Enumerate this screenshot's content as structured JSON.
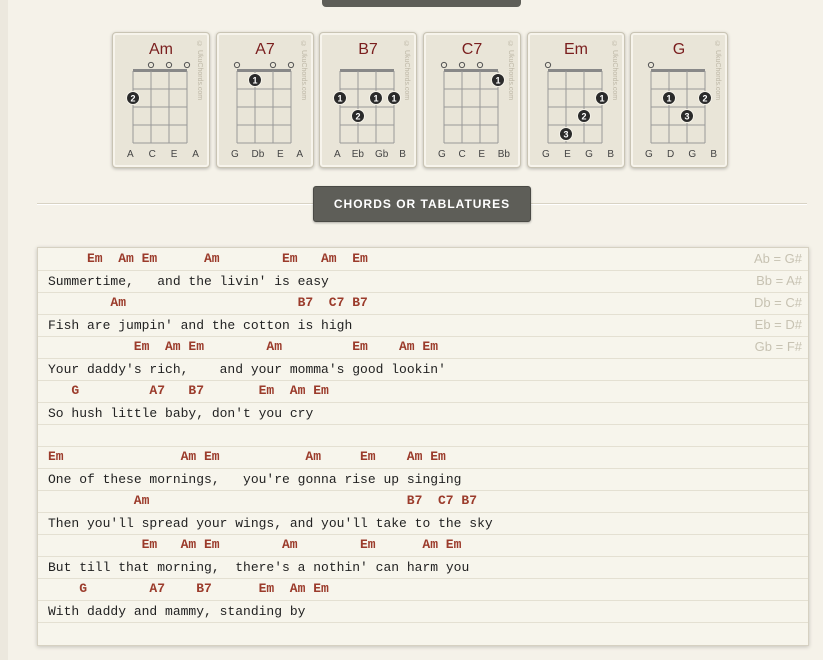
{
  "chord_cards": [
    {
      "name": "Am",
      "strings": [
        "A",
        "C",
        "E",
        "A"
      ],
      "open": [
        1,
        2,
        3
      ],
      "dots": [
        {
          "s": 0,
          "f": 1,
          "n": "2"
        }
      ]
    },
    {
      "name": "A7",
      "strings": [
        "G",
        "Db",
        "E",
        "A"
      ],
      "open": [
        0,
        2,
        3
      ],
      "dots": [
        {
          "s": 1,
          "f": 0,
          "n": "1"
        }
      ]
    },
    {
      "name": "B7",
      "strings": [
        "A",
        "Eb",
        "Gb",
        "B"
      ],
      "open": [],
      "dots": [
        {
          "s": 0,
          "f": 1,
          "n": "1"
        },
        {
          "s": 2,
          "f": 1,
          "n": "1"
        },
        {
          "s": 3,
          "f": 1,
          "n": "1"
        },
        {
          "s": 1,
          "f": 2,
          "n": "2"
        }
      ]
    },
    {
      "name": "C7",
      "strings": [
        "G",
        "C",
        "E",
        "Bb"
      ],
      "open": [
        0,
        1,
        2
      ],
      "dots": [
        {
          "s": 3,
          "f": 0,
          "n": "1"
        }
      ]
    },
    {
      "name": "Em",
      "strings": [
        "G",
        "E",
        "G",
        "B"
      ],
      "open": [
        0
      ],
      "dots": [
        {
          "s": 3,
          "f": 1,
          "n": "1"
        },
        {
          "s": 2,
          "f": 2,
          "n": "2"
        },
        {
          "s": 1,
          "f": 3,
          "n": "3"
        }
      ]
    },
    {
      "name": "G",
      "strings": [
        "G",
        "D",
        "G",
        "B"
      ],
      "open": [
        0
      ],
      "dots": [
        {
          "s": 1,
          "f": 1,
          "n": "1"
        },
        {
          "s": 3,
          "f": 1,
          "n": "2"
        },
        {
          "s": 2,
          "f": 2,
          "n": "3"
        }
      ]
    }
  ],
  "brand_text": "© UkuChords.com",
  "section_button": "CHORDS OR TABLATURES",
  "equivalents": [
    "Ab = G#",
    "Bb = A#",
    "Db = C#",
    "Eb = D#",
    "Gb = F#"
  ],
  "sheet_lines": [
    {
      "type": "chords",
      "chords": [
        {
          "c": "Em",
          "col": 5
        },
        {
          "c": "Am",
          "col": 9
        },
        {
          "c": "Em",
          "col": 12
        },
        {
          "c": "Am",
          "col": 20
        },
        {
          "c": "Em",
          "col": 30
        },
        {
          "c": "Am",
          "col": 35
        },
        {
          "c": "Em",
          "col": 39
        }
      ]
    },
    {
      "type": "lyric",
      "text": "Summertime,   and the livin' is easy"
    },
    {
      "type": "chords",
      "chords": [
        {
          "c": "Am",
          "col": 8
        },
        {
          "c": "B7",
          "col": 32
        },
        {
          "c": "C7",
          "col": 36
        },
        {
          "c": "B7",
          "col": 39
        }
      ]
    },
    {
      "type": "lyric",
      "text": "Fish are jumpin' and the cotton is high"
    },
    {
      "type": "chords",
      "chords": [
        {
          "c": "Em",
          "col": 11
        },
        {
          "c": "Am",
          "col": 15
        },
        {
          "c": "Em",
          "col": 18
        },
        {
          "c": "Am",
          "col": 28
        },
        {
          "c": "Em",
          "col": 39
        },
        {
          "c": "Am",
          "col": 45
        },
        {
          "c": "Em",
          "col": 48
        }
      ]
    },
    {
      "type": "lyric",
      "text": "Your daddy's rich,    and your momma's good lookin'"
    },
    {
      "type": "chords",
      "chords": [
        {
          "c": "G",
          "col": 3
        },
        {
          "c": "A7",
          "col": 13
        },
        {
          "c": "B7",
          "col": 18
        },
        {
          "c": "Em",
          "col": 27
        },
        {
          "c": "Am",
          "col": 31
        },
        {
          "c": "Em",
          "col": 34
        }
      ]
    },
    {
      "type": "lyric",
      "text": "So hush little baby, don't you cry"
    },
    {
      "type": "lyric",
      "text": ""
    },
    {
      "type": "chords",
      "chords": [
        {
          "c": "Em",
          "col": 0
        },
        {
          "c": "Am",
          "col": 17
        },
        {
          "c": "Em",
          "col": 20
        },
        {
          "c": "Am",
          "col": 33
        },
        {
          "c": "Em",
          "col": 40
        },
        {
          "c": "Am",
          "col": 46
        },
        {
          "c": "Em",
          "col": 49
        }
      ]
    },
    {
      "type": "lyric",
      "text": "One of these mornings,   you're gonna rise up singing"
    },
    {
      "type": "chords",
      "chords": [
        {
          "c": "Am",
          "col": 11
        },
        {
          "c": "B7",
          "col": 46
        },
        {
          "c": "C7",
          "col": 50
        },
        {
          "c": "B7",
          "col": 53
        }
      ]
    },
    {
      "type": "lyric",
      "text": "Then you'll spread your wings, and you'll take to the sky"
    },
    {
      "type": "chords",
      "chords": [
        {
          "c": "Em",
          "col": 12
        },
        {
          "c": "Am",
          "col": 17
        },
        {
          "c": "Em",
          "col": 20
        },
        {
          "c": "Am",
          "col": 30
        },
        {
          "c": "Em",
          "col": 40
        },
        {
          "c": "Am",
          "col": 48
        },
        {
          "c": "Em",
          "col": 51
        }
      ]
    },
    {
      "type": "lyric",
      "text": "But till that morning,  there's a nothin' can harm you"
    },
    {
      "type": "chords",
      "chords": [
        {
          "c": "G",
          "col": 4
        },
        {
          "c": "A7",
          "col": 13
        },
        {
          "c": "B7",
          "col": 19
        },
        {
          "c": "Em",
          "col": 27
        },
        {
          "c": "Am",
          "col": 31
        },
        {
          "c": "Em",
          "col": 34
        }
      ]
    },
    {
      "type": "lyric",
      "text": "With daddy and mammy, standing by"
    }
  ]
}
